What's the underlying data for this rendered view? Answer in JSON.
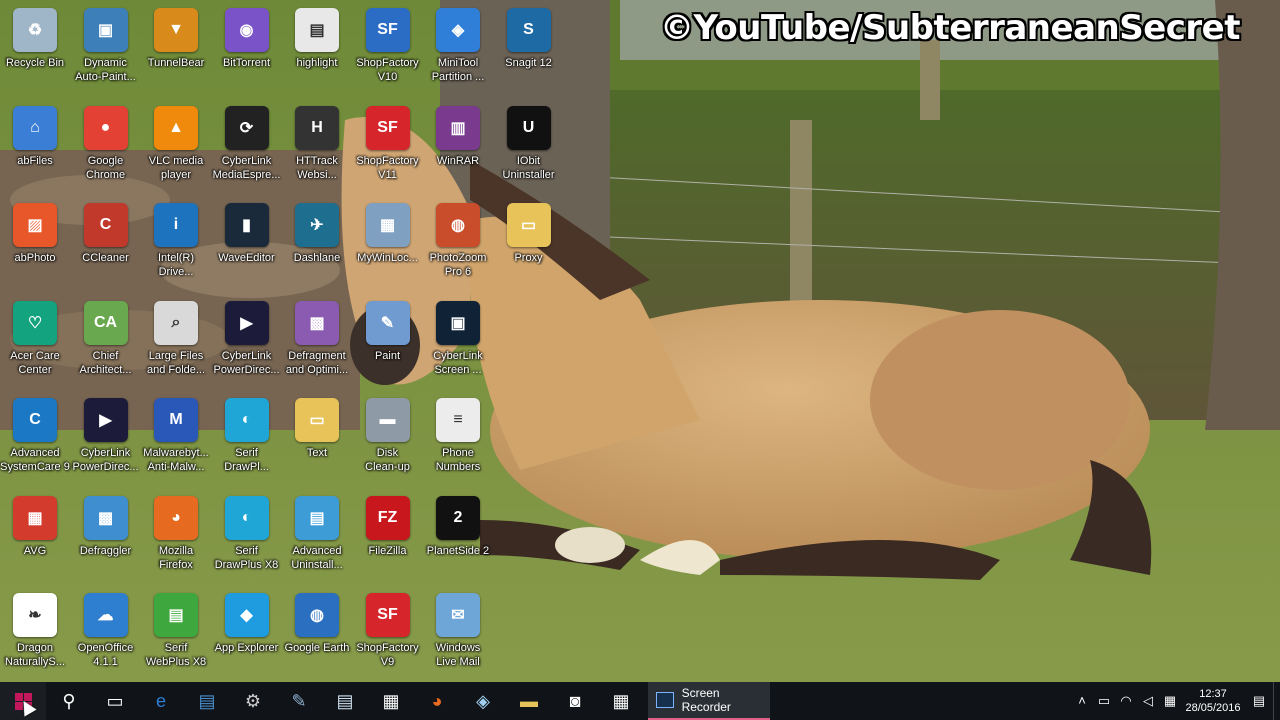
{
  "watermark": "©YouTube/SubterraneanSecret",
  "desktop_icons": [
    {
      "label": "Recycle Bin",
      "icon": "recycle-bin-icon",
      "color": "#9fb6c9",
      "glyph": "♻"
    },
    {
      "label": "Dynamic\nAuto-Paint...",
      "icon": "picture-icon",
      "color": "#3d7fb8",
      "glyph": "▣"
    },
    {
      "label": "TunnelBear",
      "icon": "bear-icon",
      "color": "#d88a1a",
      "glyph": "▼"
    },
    {
      "label": "BitTorrent",
      "icon": "bittorrent-icon",
      "color": "#7a53c9",
      "glyph": "◉"
    },
    {
      "label": "highlight",
      "icon": "document-icon",
      "color": "#e8e8e8",
      "glyph": "▤"
    },
    {
      "label": "ShopFactory\nV10",
      "icon": "shopfactory-icon",
      "color": "#2b6cc4",
      "glyph": "SF"
    },
    {
      "label": "MiniTool\nPartition ...",
      "icon": "partition-icon",
      "color": "#2f7fd8",
      "glyph": "◈"
    },
    {
      "label": "Snagit 12",
      "icon": "snagit-icon",
      "color": "#1d6aa5",
      "glyph": "S"
    },
    {
      "label": "abFiles",
      "icon": "folder-share-icon",
      "color": "#3b7ed6",
      "glyph": "⌂"
    },
    {
      "label": "Google\nChrome",
      "icon": "chrome-icon",
      "color": "#e34133",
      "glyph": "●"
    },
    {
      "label": "VLC media\nplayer",
      "icon": "vlc-cone-icon",
      "color": "#ef8a0c",
      "glyph": "▲"
    },
    {
      "label": "CyberLink\nMediaEspre...",
      "icon": "media-espresso-icon",
      "color": "#222222",
      "glyph": "⟳"
    },
    {
      "label": "HTTrack\nWebsi...",
      "icon": "httrack-icon",
      "color": "#333333",
      "glyph": "H"
    },
    {
      "label": "ShopFactory\nV11",
      "icon": "shopfactory-icon",
      "color": "#d6262c",
      "glyph": "SF"
    },
    {
      "label": "WinRAR",
      "icon": "winrar-icon",
      "color": "#7a3b8f",
      "glyph": "▥"
    },
    {
      "label": "IObit\nUninstaller",
      "icon": "iobit-icon",
      "color": "#111111",
      "glyph": "U"
    },
    {
      "label": "abPhoto",
      "icon": "photo-icon",
      "color": "#e8572a",
      "glyph": "▨"
    },
    {
      "label": "CCleaner",
      "icon": "ccleaner-icon",
      "color": "#c0392b",
      "glyph": "C"
    },
    {
      "label": "Intel(R)\nDrive...",
      "icon": "intel-icon",
      "color": "#1e73be",
      "glyph": "i"
    },
    {
      "label": "WaveEditor",
      "icon": "wave-editor-icon",
      "color": "#1a2a3a",
      "glyph": "▮"
    },
    {
      "label": "Dashlane",
      "icon": "dashlane-icon",
      "color": "#1e6f8f",
      "glyph": "✈"
    },
    {
      "label": "MyWinLoc...",
      "icon": "winlocker-icon",
      "color": "#7fa0c0",
      "glyph": "▦"
    },
    {
      "label": "PhotoZoom\nPro 6",
      "icon": "photozoom-icon",
      "color": "#c94d2a",
      "glyph": "◍"
    },
    {
      "label": "Proxy",
      "icon": "folder-icon",
      "color": "#e8c35a",
      "glyph": "▭"
    },
    {
      "label": "Acer Care\nCenter",
      "icon": "acer-care-icon",
      "color": "#14a37f",
      "glyph": "♡"
    },
    {
      "label": "Chief\nArchitect...",
      "icon": "chief-architect-icon",
      "color": "#6aa84f",
      "glyph": "CA"
    },
    {
      "label": "Large Files\nand Folde...",
      "icon": "large-files-icon",
      "color": "#d9d9d9",
      "glyph": "⌕"
    },
    {
      "label": "CyberLink\nPowerDirec...",
      "icon": "powerdirector-icon",
      "color": "#1c1c3a",
      "glyph": "▶"
    },
    {
      "label": "Defragment\nand Optimi...",
      "icon": "defrag-icon",
      "color": "#8a5bb0",
      "glyph": "▩"
    },
    {
      "label": "Paint",
      "icon": "paint-palette-icon",
      "color": "#6f9bd1",
      "glyph": "✎"
    },
    {
      "label": "CyberLink\nScreen ...",
      "icon": "screen-recorder-icon",
      "color": "#0f2236",
      "glyph": "▣"
    },
    {
      "label": "Advanced\nSystemCare 9",
      "icon": "systemcare-icon",
      "color": "#1b78c4",
      "glyph": "C"
    },
    {
      "label": "CyberLink\nPowerDirec...",
      "icon": "powerdirector-icon",
      "color": "#1c1c3a",
      "glyph": "▶"
    },
    {
      "label": "Malwarebyt...\nAnti-Malw...",
      "icon": "malwarebytes-icon",
      "color": "#2a58b8",
      "glyph": "M"
    },
    {
      "label": "Serif\nDrawPl...",
      "icon": "serif-drawplus-icon",
      "color": "#1fa6d6",
      "glyph": "◐"
    },
    {
      "label": "Text",
      "icon": "folder-icon",
      "color": "#e8c35a",
      "glyph": "▭"
    },
    {
      "label": "Disk\nClean-up",
      "icon": "disk-cleanup-icon",
      "color": "#8e9aa6",
      "glyph": "▬"
    },
    {
      "label": "Phone\nNumbers",
      "icon": "text-document-icon",
      "color": "#ececec",
      "glyph": "≡"
    },
    {
      "label": "AVG",
      "icon": "avg-icon",
      "color": "#d33b2c",
      "glyph": "▦"
    },
    {
      "label": "Defraggler",
      "icon": "defraggler-icon",
      "color": "#3e8ed0",
      "glyph": "▩"
    },
    {
      "label": "Mozilla\nFirefox",
      "icon": "firefox-icon",
      "color": "#e66a1f",
      "glyph": "◕"
    },
    {
      "label": "Serif\nDrawPlus X8",
      "icon": "serif-drawplus-icon",
      "color": "#1fa6d6",
      "glyph": "◐"
    },
    {
      "label": "Advanced\nUninstall...",
      "icon": "advanced-uninstaller-icon",
      "color": "#3d9bd6",
      "glyph": "▤"
    },
    {
      "label": "FileZilla",
      "icon": "filezilla-icon",
      "color": "#c9171e",
      "glyph": "FZ"
    },
    {
      "label": "PlanetSide 2",
      "icon": "planetside-icon",
      "color": "#111111",
      "glyph": "2"
    },
    {
      "label": "Dragon\nNaturallyS...",
      "icon": "dragon-icon",
      "color": "#ffffff",
      "glyph": "❧"
    },
    {
      "label": "OpenOffice\n4.1.1",
      "icon": "openoffice-icon",
      "color": "#2f7fd0",
      "glyph": "☁"
    },
    {
      "label": "Serif\nWebPlus X8",
      "icon": "serif-webplus-icon",
      "color": "#3ea83e",
      "glyph": "▤"
    },
    {
      "label": "App Explorer",
      "icon": "app-explorer-icon",
      "color": "#1f9be0",
      "glyph": "◆"
    },
    {
      "label": "Google Earth",
      "icon": "google-earth-icon",
      "color": "#2a6fc0",
      "glyph": "◍"
    },
    {
      "label": "ShopFactory\nV9",
      "icon": "shopfactory-icon",
      "color": "#d6262c",
      "glyph": "SF"
    },
    {
      "label": "Windows\nLive Mail",
      "icon": "live-mail-icon",
      "color": "#6fa6d8",
      "glyph": "✉"
    }
  ],
  "taskbar": {
    "pinned": [
      {
        "name": "start-button",
        "icon": "windows-logo-icon"
      },
      {
        "name": "search-button",
        "icon": "search-icon",
        "glyph": "⚲"
      },
      {
        "name": "task-view-button",
        "icon": "task-view-icon",
        "glyph": "▭"
      },
      {
        "name": "edge-button",
        "icon": "edge-icon",
        "glyph": "e",
        "color": "#2b7fd8"
      },
      {
        "name": "store-button",
        "icon": "store-icon",
        "glyph": "▤",
        "color": "#4a90d0"
      },
      {
        "name": "settings-button",
        "icon": "gear-icon",
        "glyph": "⚙",
        "color": "#cccccc"
      },
      {
        "name": "paint-button",
        "icon": "paint-palette-icon",
        "glyph": "✎",
        "color": "#8fb0d0"
      },
      {
        "name": "notepad-button",
        "icon": "notepad-icon",
        "glyph": "▤",
        "color": "#cfe0f0"
      },
      {
        "name": "store2-button",
        "icon": "windows-store-icon",
        "glyph": "▦",
        "color": "#ffffff"
      },
      {
        "name": "firefox-button",
        "icon": "firefox-icon",
        "glyph": "◕",
        "color": "#e66a1f"
      },
      {
        "name": "winrar-button",
        "icon": "archive-icon",
        "glyph": "◈",
        "color": "#9fd0ef"
      },
      {
        "name": "explorer-button",
        "icon": "folder-icon",
        "glyph": "▬",
        "color": "#e8c35a"
      },
      {
        "name": "camera-button",
        "icon": "camera-icon",
        "glyph": "◙",
        "color": "#ffffff"
      },
      {
        "name": "calculator-button",
        "icon": "calculator-icon",
        "glyph": "▦",
        "color": "#ffffff"
      }
    ],
    "active_app": "Screen Recorder",
    "tray_icons": [
      "chevron-up-icon",
      "battery-icon",
      "wifi-icon",
      "volume-icon",
      "keyboard-icon"
    ],
    "tray_glyphs": [
      "˄",
      "▭",
      "◠",
      "◁",
      "▦"
    ],
    "time": "12:37",
    "date": "28/05/2016",
    "notification_glyph": "▤"
  }
}
